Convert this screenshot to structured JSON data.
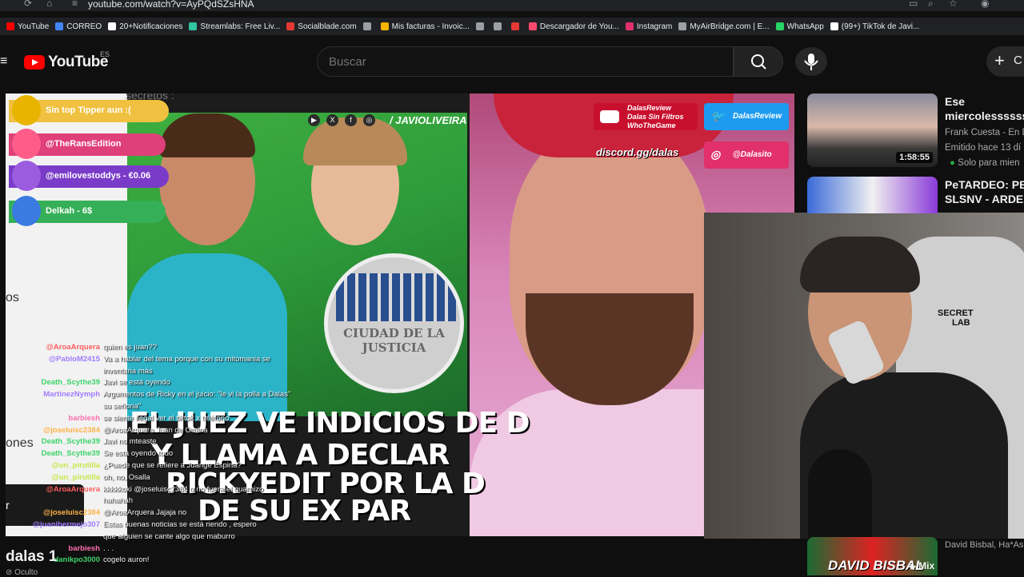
{
  "browser": {
    "url": "youtube.com/watch?v=AyPQdSZsHNA",
    "bookmarks": [
      {
        "label": "YouTube",
        "color": "#ff0000"
      },
      {
        "label": "CORREO",
        "color": "#4285f4"
      },
      {
        "label": "20+Notificaciones",
        "color": "#ffffff"
      },
      {
        "label": "Streamlabs: Free Liv...",
        "color": "#31c3a2"
      },
      {
        "label": "Socialblade.com",
        "color": "#e53935"
      },
      {
        "label": "",
        "color": "#9aa0a6"
      },
      {
        "label": "Mis facturas - Invoic...",
        "color": "#f4b400"
      },
      {
        "label": "",
        "color": "#9aa0a6"
      },
      {
        "label": "",
        "color": "#9aa0a6"
      },
      {
        "label": "",
        "color": "#e53935"
      },
      {
        "label": "Descargador de You...",
        "color": "#ff4a6e"
      },
      {
        "label": "Instagram",
        "color": "#e1306c"
      },
      {
        "label": "MyAirBridge.com | E...",
        "color": "#9aa0a6"
      },
      {
        "label": "WhatsApp",
        "color": "#25d366"
      },
      {
        "label": "(99+) TikTok de Javi...",
        "color": "#ffffff"
      }
    ]
  },
  "header": {
    "logo_text": "YouTube",
    "country": "ES",
    "search_placeholder": "Buscar",
    "create_label": "C"
  },
  "video": {
    "news_handle": "/ JAVIOLIVEIRA",
    "seal_text": "CIUDAD DE LA JUSTICIA",
    "headline1a": "EL JUEZ VE ",
    "headline1b": "INDICIOS DE D",
    "headline2": "Y LLAMA A DECLAR",
    "headline3": "RICKYEDIT POR LA D",
    "headline4": "DE SU EX PAR",
    "top_text": "secretos :",
    "alerts": [
      {
        "text": "Sin top Tipper aun :(",
        "color": "#f0c040",
        "badge": "#e8b400"
      },
      {
        "text": "@TheRansEdition",
        "color": "#e0407a",
        "badge": "#ff5c8a"
      },
      {
        "text": "@emilovestoddys - €0.06",
        "color": "#7a3cc8",
        "badge": "#9c5ce0"
      },
      {
        "text": "Delkah - 6$",
        "color": "#36b058",
        "badge": "#3b7ae0"
      }
    ],
    "promo": {
      "youtube_line1": "DalasReview",
      "youtube_line2": "Dalas Sin Filtros",
      "youtube_line3": "WhoTheGame",
      "twitter": "DalasReview",
      "discord": "discord.gg/dalas",
      "instagram": "@Dalasito"
    },
    "left_edge_1": "os",
    "left_edge_2": "ones",
    "left_dark": "r",
    "webcam_brand_1": "SECRET",
    "webcam_brand_2": "LAB"
  },
  "chat": [
    {
      "user": "@AroaArquera",
      "color": "#ff5c5c",
      "msg": "quien es juan??"
    },
    {
      "user": "@PabloM2415",
      "color": "#9f7cff",
      "msg": "Va a hablar del tema porque con su mitomania se"
    },
    {
      "user": "",
      "color": "#ffffff",
      "msg": "inventaria más"
    },
    {
      "user": "Death_Scythe39",
      "color": "#3ed36a",
      "msg": "Javi se está oyendo"
    },
    {
      "user": "MartinezNymph",
      "color": "#9f7cff",
      "msg": "Argumentos de Ricky en el juicio: \"le vi la polla a Dalas\""
    },
    {
      "user": "",
      "color": "#ffffff",
      "msg": "su señoria\""
    },
    {
      "user": "barbiesh",
      "color": "#ff6fae",
      "msg": "se siente ilegal ver el tiktok x teléfono"
    },
    {
      "user": "@joseluisc2384",
      "color": "#ffb347",
      "msg": "@AroaArquera Juan de Omlna"
    },
    {
      "user": "Death_Scythe39",
      "color": "#3ed36a",
      "msg": "Javi no mteaste"
    },
    {
      "user": "Death_Scythe39",
      "color": "#3ed36a",
      "msg": "Se está oyendo todo"
    },
    {
      "user": "@un_pirutilla",
      "color": "#c7e84a",
      "msg": "¿Puede que se refiere a Juange Espina?"
    },
    {
      "user": "@un_pirutilla",
      "color": "#c7e84a",
      "msg": "oh, no, Osalla"
    },
    {
      "user": "@AroaArquera",
      "color": "#ff5c5c",
      "msg": "kkkkkoki @joseluisc2384 q no fuera el guarnizo"
    },
    {
      "user": "",
      "color": "#ffffff",
      "msg": "hahahah"
    },
    {
      "user": "@joseluisc2384",
      "color": "#ffb347",
      "msg": "@AroaArquera Jajaja no"
    },
    {
      "user": "@juanibermejo307",
      "color": "#9f7cff",
      "msg": "Estas buenas noticias se está riendo , espero"
    },
    {
      "user": "",
      "color": "#ff5c5c",
      "msg": "que alguien se cante algo que maburro"
    },
    {
      "user": "barbiesh",
      "color": "#ff6fae",
      "msg": ". . ."
    },
    {
      "user": "danikpo3000",
      "color": "#3ed36a",
      "msg": "cogelo auron!"
    }
  ],
  "sidebar": {
    "recommendations": [
      {
        "title": "Ese",
        "title2": "miercolesssssss",
        "channel": "Frank Cuesta - En D",
        "meta": "Emitido hace 13 dí",
        "badge": "Solo para mien",
        "duration": "1:58:55"
      },
      {
        "title": "PeTARDEO: PEP",
        "title2": "SLSNV - ARDE T",
        "channel": "",
        "meta": "",
        "badge": "",
        "duration": ""
      }
    ],
    "mix": {
      "name": "DAVID BISBAL",
      "label": "Mix",
      "meta": "David Bisbal, Ha*As"
    }
  },
  "below_player": {
    "title": "dalas 1",
    "subtitle": "Oculto"
  }
}
